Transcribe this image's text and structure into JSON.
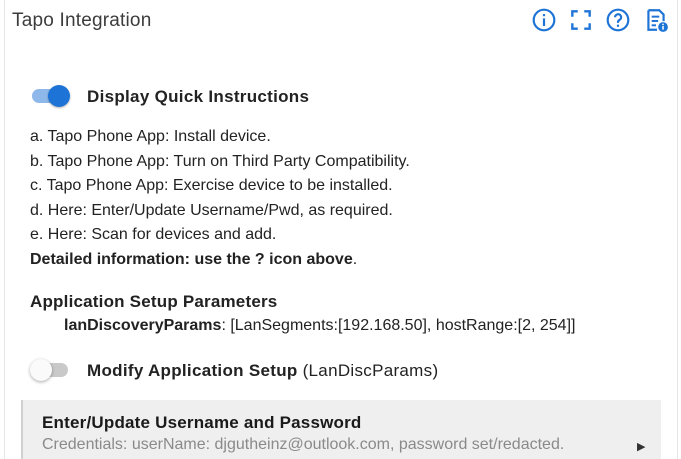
{
  "header": {
    "title": "Tapo Integration",
    "icons": [
      "info-icon",
      "fullscreen-icon",
      "help-icon",
      "document-info-icon"
    ],
    "accent_color": "#1e74d6"
  },
  "quick_instructions": {
    "label": "Display Quick Instructions",
    "enabled": true,
    "lines": [
      "a. Tapo Phone App: Install device.",
      "b. Tapo Phone App: Turn on Third Party Compatibility.",
      "c. Tapo Phone App: Exercise device to be installed.",
      "d. Here: Enter/Update Username/Pwd, as required.",
      "e. Here: Scan for devices and add."
    ],
    "detail_bold": "Detailed information: use the ? icon above",
    "detail_end": "."
  },
  "app_setup": {
    "title": "Application Setup Parameters",
    "param_key": "lanDiscoveryParams",
    "param_value": ": [LanSegments:[192.168.50], hostRange:[2, 254]]"
  },
  "modify_setup": {
    "label": "Modify Application Setup",
    "label_suffix": "(LanDiscParams)",
    "enabled": false
  },
  "credentials": {
    "title": "Enter/Update Username and Password",
    "subtitle": "Credentials: userName: djgutheinz@outlook.com, password set/redacted.",
    "arrow": "▶"
  }
}
